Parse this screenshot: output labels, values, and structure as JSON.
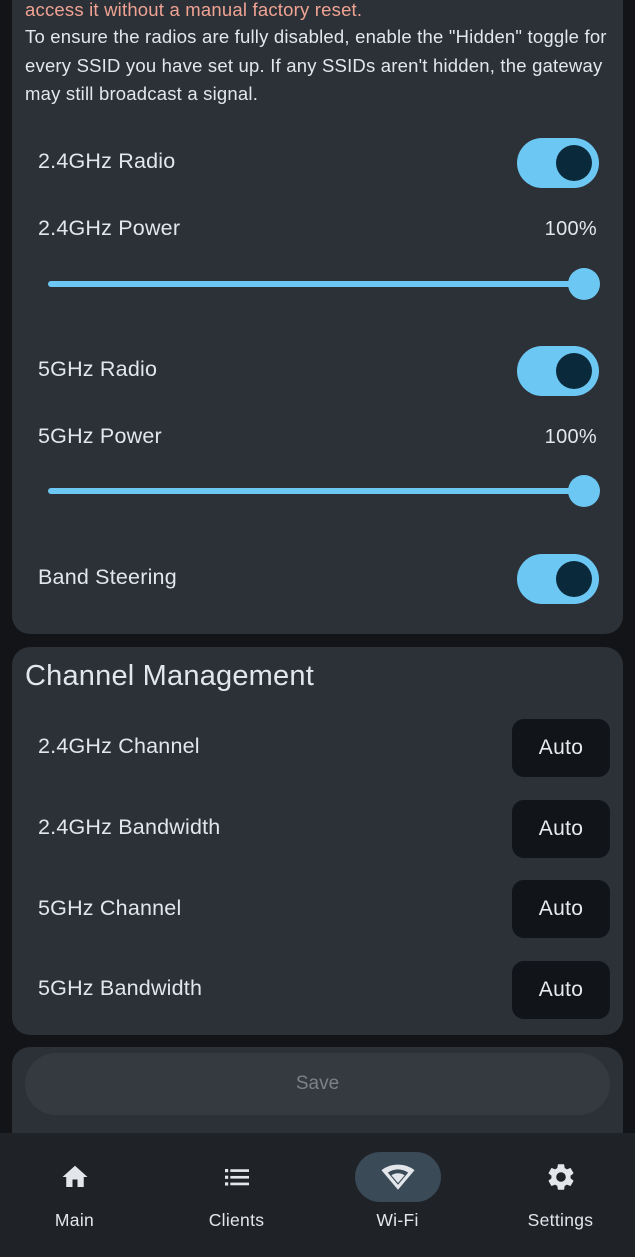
{
  "warning": {
    "red_text": "access it without a manual factory reset.",
    "body_text": "To ensure the radios are fully disabled, enable the \"Hidden\" toggle for every SSID you have set up. If any SSIDs aren't hidden, the gateway may still broadcast a signal."
  },
  "radio_24": {
    "label": "2.4GHz Radio",
    "enabled": true
  },
  "power_24": {
    "label": "2.4GHz Power",
    "value_text": "100%",
    "value": 100
  },
  "radio_5": {
    "label": "5GHz Radio",
    "enabled": true
  },
  "power_5": {
    "label": "5GHz Power",
    "value_text": "100%",
    "value": 100
  },
  "band_steering": {
    "label": "Band Steering",
    "enabled": true
  },
  "channel_management": {
    "title": "Channel Management",
    "rows": [
      {
        "label": "2.4GHz Channel",
        "value": "Auto"
      },
      {
        "label": "2.4GHz Bandwidth",
        "value": "Auto"
      },
      {
        "label": "5GHz Channel",
        "value": "Auto"
      },
      {
        "label": "5GHz Bandwidth",
        "value": "Auto"
      }
    ]
  },
  "save": {
    "label": "Save",
    "enabled": false
  },
  "nav": {
    "items": [
      {
        "label": "Main",
        "icon": "home-icon"
      },
      {
        "label": "Clients",
        "icon": "list-icon"
      },
      {
        "label": "Wi-Fi",
        "icon": "wifi-icon",
        "active": true
      },
      {
        "label": "Settings",
        "icon": "gear-icon"
      }
    ]
  },
  "colors": {
    "accent": "#6cc7f3",
    "warning": "#f0a392",
    "card": "#2c3138",
    "background": "#121417"
  }
}
